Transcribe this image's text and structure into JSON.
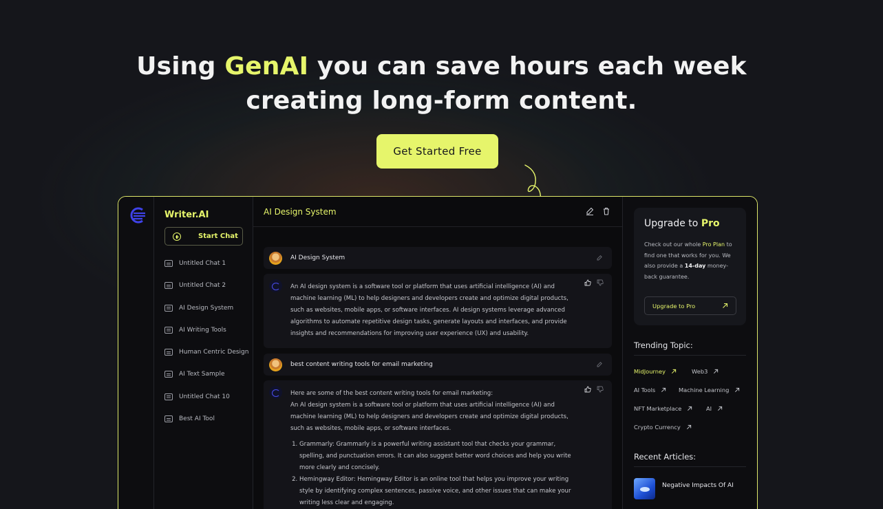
{
  "hero": {
    "title_before": "Using ",
    "title_accent": "GenAI",
    "title_after_line1": " you can save hours each week",
    "title_line2": "creating long-form content.",
    "cta_label": "Get Started Free"
  },
  "colors": {
    "accent": "#e6f56b",
    "background": "#15161b",
    "panel": "#0b0b0d",
    "card": "#141419"
  },
  "sidebar": {
    "brand": "Writer.AI",
    "start_chat": "Start Chat",
    "items": [
      {
        "label": "Untitled Chat 1"
      },
      {
        "label": "Untitled Chat 2"
      },
      {
        "label": "AI Design System"
      },
      {
        "label": "AI Writing Tools"
      },
      {
        "label": "Human Centric Design"
      },
      {
        "label": "AI Text Sample"
      },
      {
        "label": "Untitled Chat 10"
      },
      {
        "label": "Best AI Tool"
      }
    ]
  },
  "main": {
    "title": "AI Design System",
    "messages": [
      {
        "role": "user",
        "text": "AI Design System"
      },
      {
        "role": "assistant",
        "text": "An AI design system is a software tool or platform that uses artificial intelligence (AI) and machine learning (ML) to help designers and developers create and optimize digital products, such as websites, mobile apps, or software interfaces. AI design systems leverage advanced algorithms to automate repetitive design tasks, generate layouts and interfaces, and provide insights and recommendations for improving user experience (UX) and usability."
      },
      {
        "role": "user",
        "text": "best content writing tools for email marketing"
      },
      {
        "role": "assistant",
        "intro": "Here are some of the best content writing tools for email marketing:",
        "paragraph": "An AI design system is a software tool or platform that uses artificial intelligence (AI) and machine learning (ML) to help designers and developers create and optimize digital products, such as websites, mobile apps, or software interfaces.",
        "list": [
          "Grammarly: Grammarly is a powerful writing assistant tool that checks your grammar, spelling, and punctuation errors. It can also suggest better word choices and help you write more clearly and concisely.",
          "Hemingway Editor: Hemingway Editor is an online tool that helps you improve your writing style by identifying complex sentences, passive voice, and other issues that can make your writing less clear and engaging."
        ]
      }
    ]
  },
  "right": {
    "upgrade": {
      "title_before": "Upgrade to ",
      "title_pro": "Pro",
      "desc_1": "Check out our whole ",
      "desc_hl": "Pro Plan",
      "desc_2": " to find one that works for you. We also provide a ",
      "desc_bold": "14-day",
      "desc_3": " money-back guarantee.",
      "button": "Upgrade to Pro"
    },
    "trending_title": "Trending Topic:",
    "topics": [
      "MidJourney",
      "Web3",
      "AI Tools",
      "Machine Learning",
      "NFT Marketplace",
      "AI",
      "Crypto Currency"
    ],
    "recent_title": "Recent Articles:",
    "articles": [
      {
        "title": "Negative Impacts Of AI"
      }
    ]
  }
}
